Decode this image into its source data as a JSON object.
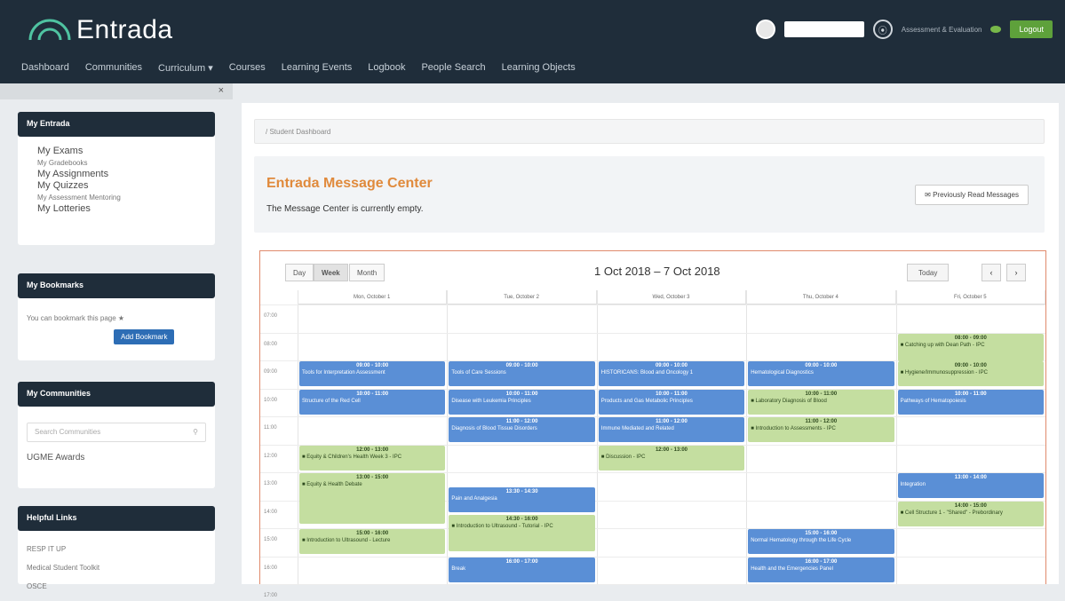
{
  "app": {
    "logo_text": "Entrada",
    "nav": [
      "Dashboard",
      "Communities",
      "Curriculum ▾",
      "Courses",
      "Learning Events",
      "Logbook",
      "People Search",
      "Learning Objects"
    ],
    "user_role": "Assessment & Evaluation",
    "logout_label": "Logout",
    "collapse_icon": "×"
  },
  "sidebar": {
    "my_entrada": {
      "title": "My Entrada",
      "links": [
        "My Exams",
        "My Gradebooks",
        "My Assignments",
        "My Quizzes",
        "My Assessment Mentoring",
        "My Lotteries"
      ],
      "small_links": [
        false,
        true,
        false,
        false,
        true,
        false
      ]
    },
    "bookmarks": {
      "title": "My Bookmarks",
      "note": "You can bookmark this page ★",
      "button": "Add Bookmark"
    },
    "communities": {
      "title": "My Communities",
      "search_placeholder": "Search Communities",
      "link": "UGME Awards"
    },
    "helpful": {
      "title": "Helpful Links",
      "links": [
        "RESP IT UP",
        "Medical Student Toolkit",
        "OSCE"
      ]
    }
  },
  "main": {
    "breadcrumb": "/ Student Dashboard",
    "message_center": {
      "title": "Entrada Message Center",
      "text": "The Message Center is currently empty.",
      "button": "✉ Previously Read Messages"
    }
  },
  "calendar": {
    "views": [
      "Day",
      "Week",
      "Month"
    ],
    "active_view": "Week",
    "title": "1 Oct 2018 – 7 Oct 2018",
    "today_label": "Today",
    "prev": "‹",
    "next": "›",
    "days": [
      "Mon, October 1",
      "Tue, October 2",
      "Wed, October 3",
      "Thu, October 4",
      "Fri, October 5"
    ],
    "times": [
      "07:00",
      "08:00",
      "09:00",
      "10:00",
      "11:00",
      "12:00",
      "13:00",
      "14:00",
      "15:00",
      "16:00",
      "17:00"
    ],
    "events": [
      {
        "day": 4,
        "start": 1.0,
        "dur": 1.0,
        "color": "green",
        "time": "08:00 - 09:00",
        "title": "■ Catching up with Dean Path - IPC"
      },
      {
        "day": 4,
        "start": 2.0,
        "dur": 0.9,
        "color": "green",
        "time": "09:00 - 10:00",
        "title": "■ Hygiene/Immunosuppression - IPC"
      },
      {
        "day": 0,
        "start": 2.0,
        "dur": 0.9,
        "color": "blue",
        "time": "09:00 - 10:00",
        "title": "Tools for Interpretation Assessment"
      },
      {
        "day": 1,
        "start": 2.0,
        "dur": 0.9,
        "color": "blue",
        "time": "09:00 - 10:00",
        "title": "Tools of Care Sessions"
      },
      {
        "day": 2,
        "start": 2.0,
        "dur": 0.9,
        "color": "blue",
        "time": "09:00 - 10:00",
        "title": "HISTORICANS: Blood and Oncology 1"
      },
      {
        "day": 3,
        "start": 2.0,
        "dur": 0.9,
        "color": "blue",
        "time": "09:00 - 10:00",
        "title": "Hematological Diagnostics"
      },
      {
        "day": 0,
        "start": 3.0,
        "dur": 0.9,
        "color": "blue",
        "time": "10:00 - 11:00",
        "title": "Structure of the Red Cell"
      },
      {
        "day": 1,
        "start": 3.0,
        "dur": 0.9,
        "color": "blue",
        "time": "10:00 - 11:00",
        "title": "Disease with Leukemia Principles"
      },
      {
        "day": 2,
        "start": 3.0,
        "dur": 0.9,
        "color": "blue",
        "time": "10:00 - 11:00",
        "title": "Products and Gas Metabolic Principles"
      },
      {
        "day": 3,
        "start": 3.0,
        "dur": 0.9,
        "color": "green",
        "time": "10:00 - 11:00",
        "title": "■ Laboratory Diagnosis of Blood"
      },
      {
        "day": 4,
        "start": 3.0,
        "dur": 0.9,
        "color": "blue",
        "time": "10:00 - 11:00",
        "title": "Pathways of Hematopoiesis"
      },
      {
        "day": 1,
        "start": 4.0,
        "dur": 0.9,
        "color": "blue",
        "time": "11:00 - 12:00",
        "title": "Diagnosis of Blood Tissue Disorders"
      },
      {
        "day": 2,
        "start": 4.0,
        "dur": 0.9,
        "color": "blue",
        "time": "11:00 - 12:00",
        "title": "Immune Mediated and Related"
      },
      {
        "day": 3,
        "start": 4.0,
        "dur": 0.9,
        "color": "green",
        "time": "11:00 - 12:00",
        "title": "■ Introduction to Assessments - IPC"
      },
      {
        "day": 0,
        "start": 5.0,
        "dur": 0.9,
        "color": "green",
        "time": "12:00 - 13:00",
        "title": "■ Equity & Children's Health Week 3 - IPC"
      },
      {
        "day": 2,
        "start": 5.0,
        "dur": 0.9,
        "color": "green",
        "time": "12:00 - 13:00",
        "title": "■ Discussion - IPC"
      },
      {
        "day": 0,
        "start": 6.0,
        "dur": 1.8,
        "color": "green",
        "time": "13:00 - 15:00",
        "title": "■ Equity & Health Debate"
      },
      {
        "day": 4,
        "start": 6.0,
        "dur": 0.9,
        "color": "blue",
        "time": "13:00 - 14:00",
        "title": "Integration"
      },
      {
        "day": 1,
        "start": 6.5,
        "dur": 0.9,
        "color": "blue",
        "time": "13:30 - 14:30",
        "title": "Pain and Analgesia"
      },
      {
        "day": 1,
        "start": 7.5,
        "dur": 1.3,
        "color": "green",
        "time": "14:30 - 16:00",
        "title": "■ Introduction to Ultrasound - Tutorial - IPC"
      },
      {
        "day": 4,
        "start": 7.0,
        "dur": 0.9,
        "color": "green",
        "time": "14:00 - 15:00",
        "title": "■ Cell Structure 1 - \"Shared\" - Prebordinary"
      },
      {
        "day": 0,
        "start": 8.0,
        "dur": 0.9,
        "color": "green",
        "time": "15:00 - 16:00",
        "title": "■ Introduction to Ultrasound - Lecture"
      },
      {
        "day": 3,
        "start": 8.0,
        "dur": 0.9,
        "color": "blue",
        "time": "15:00 - 16:00",
        "title": "Normal Hematology through the Life Cycle"
      },
      {
        "day": 1,
        "start": 9.0,
        "dur": 0.9,
        "color": "blue",
        "time": "16:00 - 17:00",
        "title": "Break"
      },
      {
        "day": 3,
        "start": 9.0,
        "dur": 0.9,
        "color": "blue",
        "time": "16:00 - 17:00",
        "title": "Health and the Emergencies Panel"
      }
    ]
  },
  "colors": {
    "topbar": "#1f2d3a",
    "accent_orange": "#e08a3c",
    "event_blue": "#5a8fd6",
    "event_green": "#c4dea0",
    "logout_green": "#5ea13b"
  }
}
